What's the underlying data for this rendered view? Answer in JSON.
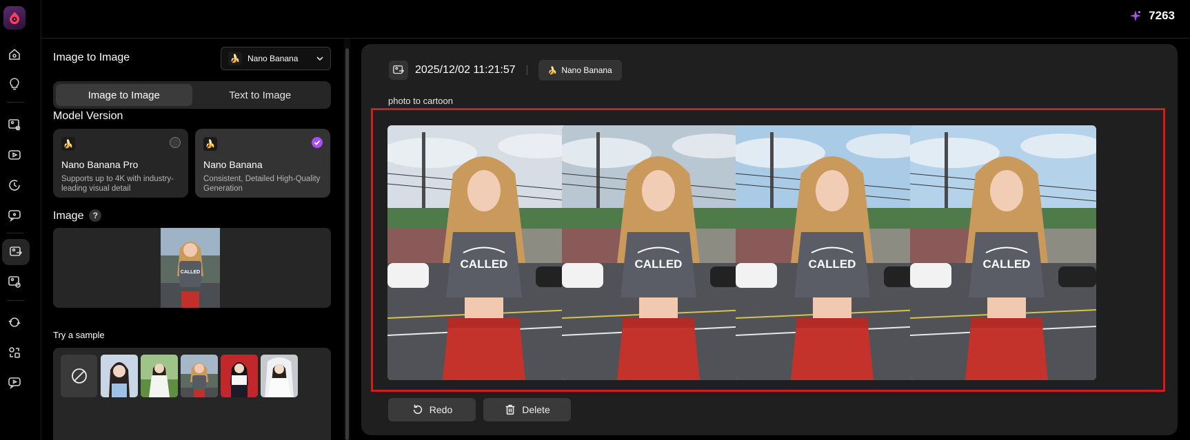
{
  "header": {
    "credits": "7263"
  },
  "sidebar": {
    "items": [
      {
        "name": "home",
        "icon": "home-icon"
      },
      {
        "name": "ideas",
        "icon": "lightbulb-icon"
      },
      {
        "name": "image-tools",
        "icon": "image-edit-icon"
      },
      {
        "name": "video",
        "icon": "video-icon"
      },
      {
        "name": "history",
        "icon": "history-icon"
      },
      {
        "name": "chat",
        "icon": "chat-icon"
      },
      {
        "name": "image-to-image",
        "icon": "image-to-image-icon",
        "active": true
      },
      {
        "name": "image-settings",
        "icon": "image-settings-icon"
      },
      {
        "name": "face-swap",
        "icon": "face-swap-icon"
      },
      {
        "name": "transform",
        "icon": "transform-icon"
      },
      {
        "name": "video-chat",
        "icon": "video-chat-icon"
      }
    ]
  },
  "panel": {
    "title": "Image to Image",
    "model_select": "Nano Banana",
    "tabs": [
      {
        "label": "Image to Image",
        "active": true
      },
      {
        "label": "Text to Image",
        "active": false
      }
    ],
    "model_version_label": "Model Version",
    "models": [
      {
        "name": "Nano Banana Pro",
        "desc": "Supports up to 4K with industry-leading visual detail",
        "selected": false
      },
      {
        "name": "Nano Banana",
        "desc": "Consistent, Detailed High-Quality Generation",
        "selected": true
      }
    ],
    "image_label": "Image",
    "image_help": "?",
    "samples_label": "Try a sample"
  },
  "result": {
    "timestamp": "2025/12/02 11:21:57",
    "model": "Nano Banana",
    "prompt": "photo to cartoon",
    "image_count": 4,
    "redo_label": "Redo",
    "delete_label": "Delete"
  },
  "colors": {
    "accent": "#a94ef0",
    "highlight_frame": "#d41c1c",
    "panel_bg": "#262626",
    "main_bg": "#1f1f1f"
  }
}
